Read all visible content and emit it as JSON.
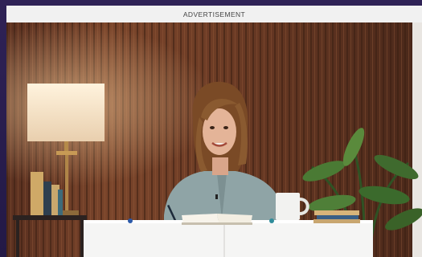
{
  "ad": {
    "label": "ADVERTISEMENT"
  },
  "colors": {
    "background": "#2a1d4e",
    "ad_bar": "#f1f1f1",
    "ad_text": "#444444",
    "wall": "#6b3a24",
    "desk": "#f5f5f4",
    "lamp_shade": "#f6e6cf",
    "shirt": "#8fa4a6",
    "mug": "#f2f2f0",
    "plant": "#3f6a2e"
  },
  "scene": {
    "icon": "video-ad-scene"
  }
}
